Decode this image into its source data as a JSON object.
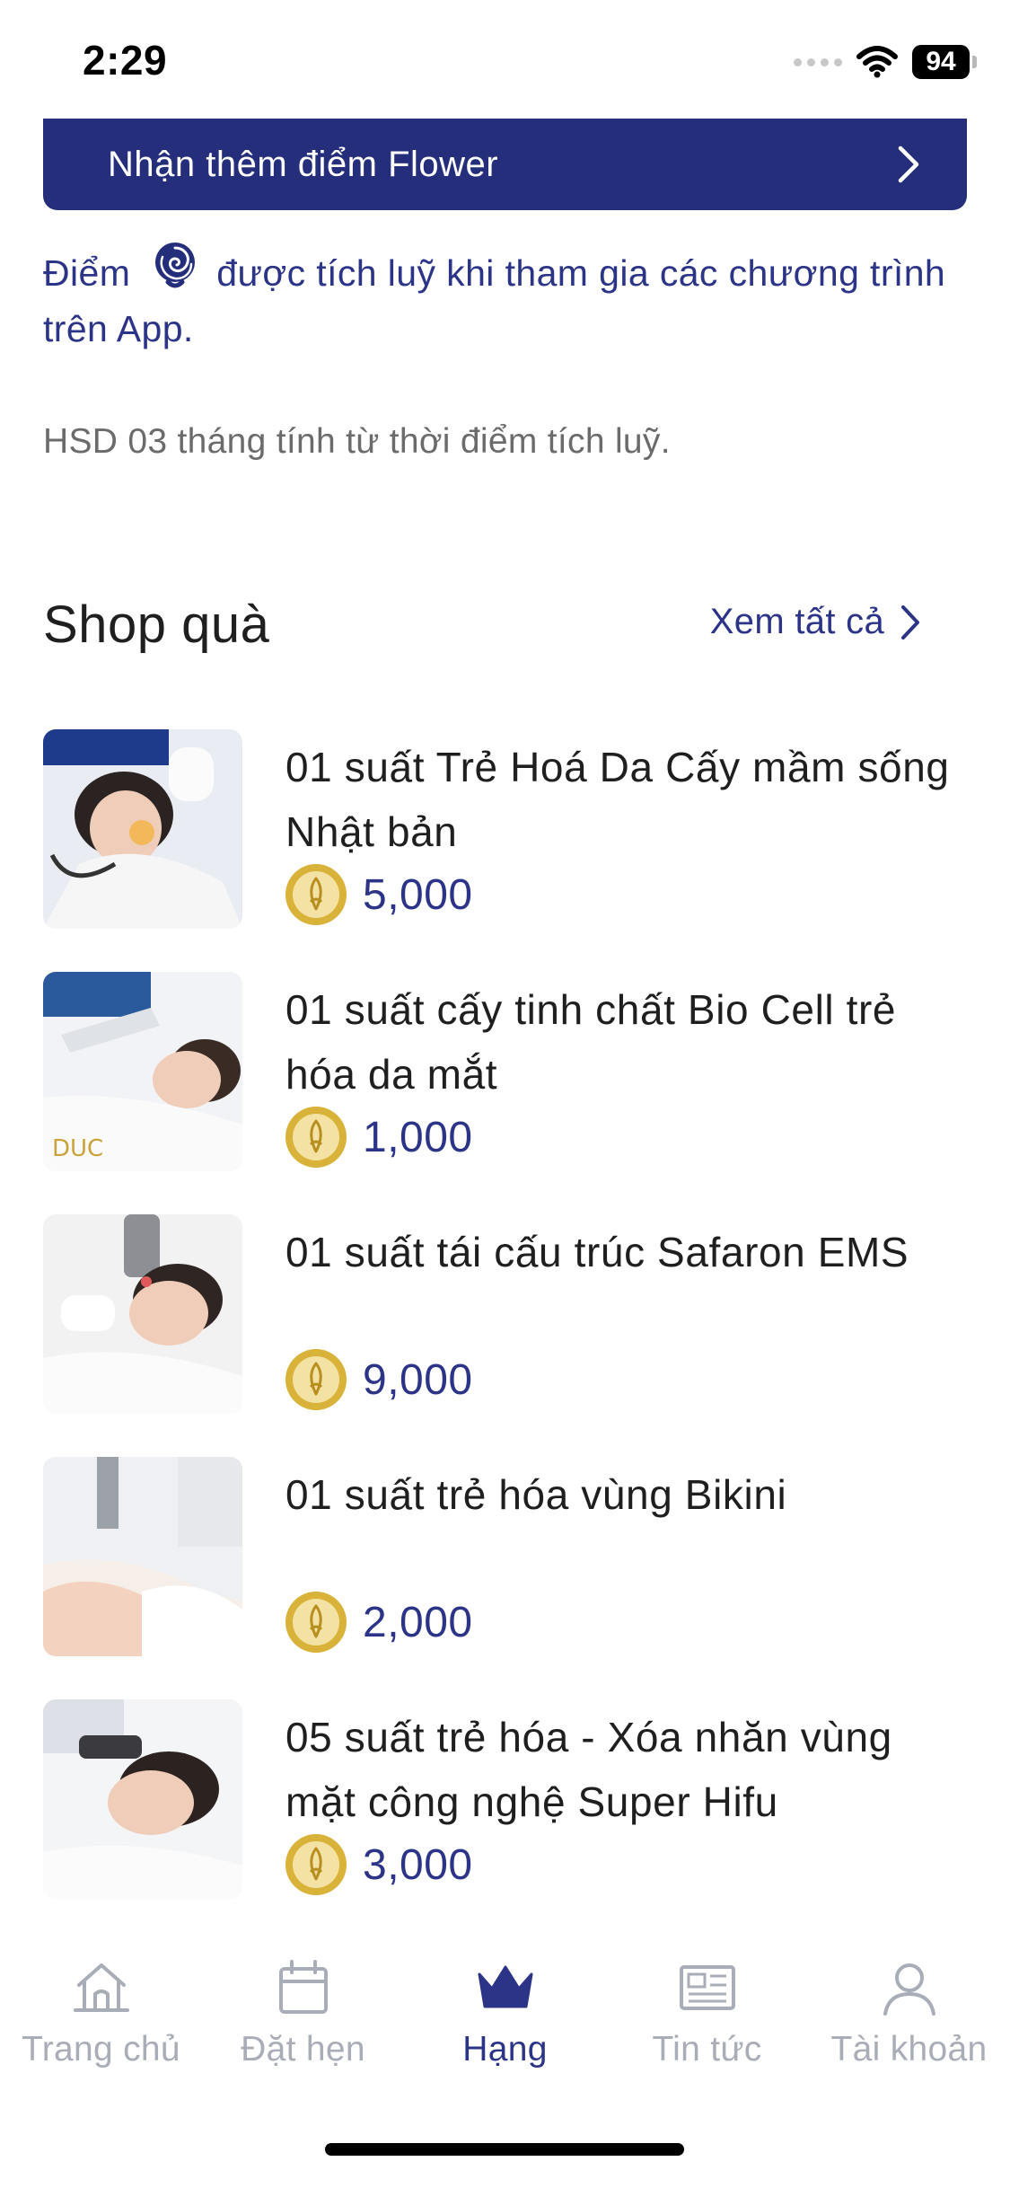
{
  "status_bar": {
    "time": "2:29",
    "battery": "94"
  },
  "banner": {
    "label": "Nhận thêm điểm Flower"
  },
  "info": {
    "text_before": "Điểm",
    "text_after": "được tích luỹ khi tham gia các chương trình trên App.",
    "expiry": "HSD 03 tháng tính từ thời điểm tích luỹ."
  },
  "shop": {
    "title": "Shop quà",
    "see_all": "Xem tất cả",
    "items": [
      {
        "name": "01 suất Trẻ Hoá Da Cấy mầm sống Nhật bản",
        "price": "5,000"
      },
      {
        "name": "01 suất cấy tinh chất Bio Cell trẻ hóa da mắt",
        "price": "1,000"
      },
      {
        "name": "01 suất tái cấu trúc Safaron EMS",
        "price": "9,000"
      },
      {
        "name": "01 suất trẻ hóa vùng Bikini",
        "price": "2,000"
      },
      {
        "name": "05 suất trẻ hóa - Xóa nhăn vùng mặt công nghệ Super Hifu",
        "price": "3,000"
      }
    ]
  },
  "tabs": [
    {
      "label": "Trang chủ",
      "icon": "home-icon"
    },
    {
      "label": "Đặt hẹn",
      "icon": "calendar-icon"
    },
    {
      "label": "Hạng",
      "icon": "crown-icon",
      "active": true
    },
    {
      "label": "Tin tức",
      "icon": "news-icon"
    },
    {
      "label": "Tài khoản",
      "icon": "account-icon"
    }
  ],
  "colors": {
    "brand": "#252e7a",
    "accent_text": "#2b3486",
    "coin_gold": "#d9b23a",
    "inactive": "#a9adb8"
  }
}
